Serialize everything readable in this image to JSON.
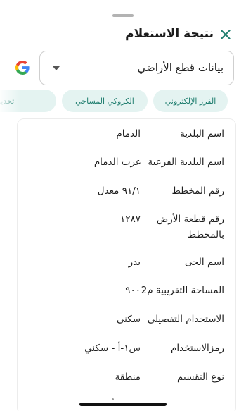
{
  "header": {
    "title": "نتيجة الاستعلام"
  },
  "select": {
    "value": "بيانات قطع الأراضي"
  },
  "chips": [
    {
      "label": "الفرز الإلكتروني"
    },
    {
      "label": "الكروكي المساحي"
    },
    {
      "label": "تحديث ال"
    }
  ],
  "details": [
    {
      "label": "اسم البلدية",
      "value": "الدمام"
    },
    {
      "label": "اسم البلدية الفرعية",
      "value": "غرب الدمام"
    },
    {
      "label": "رقم المخطط",
      "value": "٩١/١ معدل"
    },
    {
      "label": "رقم قطعة الأرض بالمخطط",
      "value": "١٢٨٧"
    },
    {
      "label": "اسم الحى",
      "value": "بدر"
    },
    {
      "label": "المساحة التقريبية م2",
      "value": "٩٠٠"
    },
    {
      "label": "الاستخدام التفصيلى",
      "value": "سكنى"
    },
    {
      "label": "رمزالاستخدام",
      "value": "س١-أ - سكني"
    },
    {
      "label": "نوع التقسيم",
      "value": "منطقة"
    }
  ],
  "colors": {
    "accent": "#1e7d6e",
    "chip_bg": "#e4f3f1",
    "border": "#cfcfcf"
  },
  "icons": {
    "close": "close-icon",
    "google": "google-icon",
    "dropdown": "chevron-down-icon"
  }
}
